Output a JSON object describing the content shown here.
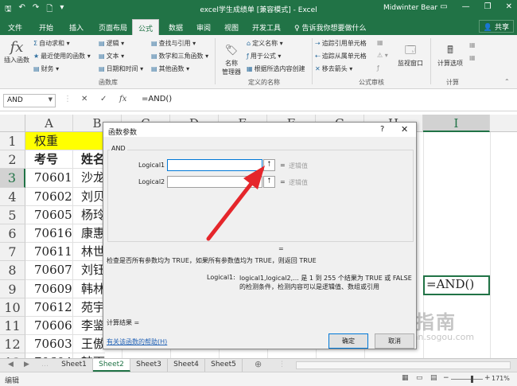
{
  "titlebar": {
    "title": "excel学生成绩单 [兼容模式] - Excel",
    "user": "Midwinter Bear",
    "qat": [
      "save-icon",
      "undo-icon",
      "redo-icon",
      "new-icon",
      "customize-icon"
    ],
    "min": "—",
    "restore": "❐",
    "close": "✕"
  },
  "tabs": {
    "items": [
      "文件",
      "开始",
      "插入",
      "页面布局",
      "公式",
      "数据",
      "审阅",
      "视图",
      "开发工具",
      "♀ 告诉我你想要做什么"
    ],
    "active": "公式",
    "share": "共享"
  },
  "ribbon": {
    "insert_fn": "插入函数",
    "autosum": "自动求和",
    "recent": "最近使用的函数",
    "finance": "财务",
    "logic": "逻辑",
    "text": "文本",
    "datetime": "日期和时间",
    "lookup": "查找与引用",
    "math": "数学和三角函数",
    "other": "其他函数",
    "group_library": "函数库",
    "name_mgr_1": "名称",
    "name_mgr_2": "管理器",
    "define_name": "定义名称",
    "use_in_formula": "用于公式",
    "create_from_sel": "根据所选内容创建",
    "group_names": "定义的名称",
    "trace_prec": "追踪引用单元格",
    "trace_dep": "追踪从属单元格",
    "remove_arrows": "移去箭头",
    "group_audit": "公式审核",
    "watch": "监视窗口",
    "calc_options": "计算选项",
    "group_calc": "计算"
  },
  "formula_bar": {
    "name_box": "AND",
    "cancel": "✕",
    "enter": "✓",
    "fx": "fx",
    "formula": "=AND()"
  },
  "grid": {
    "columns": [
      "A",
      "B",
      "C",
      "D",
      "E",
      "F",
      "G",
      "H",
      "I"
    ],
    "rows": [
      "1",
      "2",
      "3",
      "4",
      "5",
      "6",
      "7",
      "8",
      "9",
      "10",
      "11",
      "12",
      "13"
    ],
    "colA": [
      "权重",
      "考号",
      "70601",
      "70602",
      "70605",
      "70616",
      "70611",
      "70607",
      "70609",
      "70612",
      "70606",
      "70603",
      "70604"
    ],
    "colB": [
      "",
      "姓名",
      "沙龙",
      "刘贝",
      "杨玲",
      "康惠",
      "林世",
      "刘钰",
      "韩林",
      "苑宇",
      "李鉴",
      "王傲",
      "韩雨"
    ],
    "active_cell_value": "=AND()"
  },
  "dialog": {
    "title": "函数参数",
    "help_q": "?",
    "close": "✕",
    "function": "AND",
    "arg1_label": "Logical1",
    "arg2_label": "Logical2",
    "arg_value_hint": "逻辑值",
    "eq": "=",
    "ref_icon": "⭡",
    "description": "检查是否所有参数均为 TRUE，如果所有参数值均为 TRUE，则返回 TRUE",
    "arg_name": "Logical1:",
    "arg_desc": "logical1,logical2,... 是 1 到 255 个结果为 TRUE 或 FALSE 的检测条件，检测内容可以是逻辑值、数组或引用",
    "calc_result": "计算结果 =",
    "help_link": "有关该函数的帮助(H)",
    "ok": "确定",
    "cancel": "取消"
  },
  "sheets": {
    "items": [
      "Sheet1",
      "Sheet2",
      "Sheet3",
      "Sheet4",
      "Sheet5"
    ],
    "active": "Sheet2",
    "add": "⊕"
  },
  "status": {
    "mode": "编辑",
    "zoom": "171%"
  },
  "watermark": {
    "text": "搜狗指南",
    "sub": "zhinan.sogou.com"
  },
  "colors": {
    "excel_green": "#217346",
    "arrow_red": "#e5262b"
  }
}
